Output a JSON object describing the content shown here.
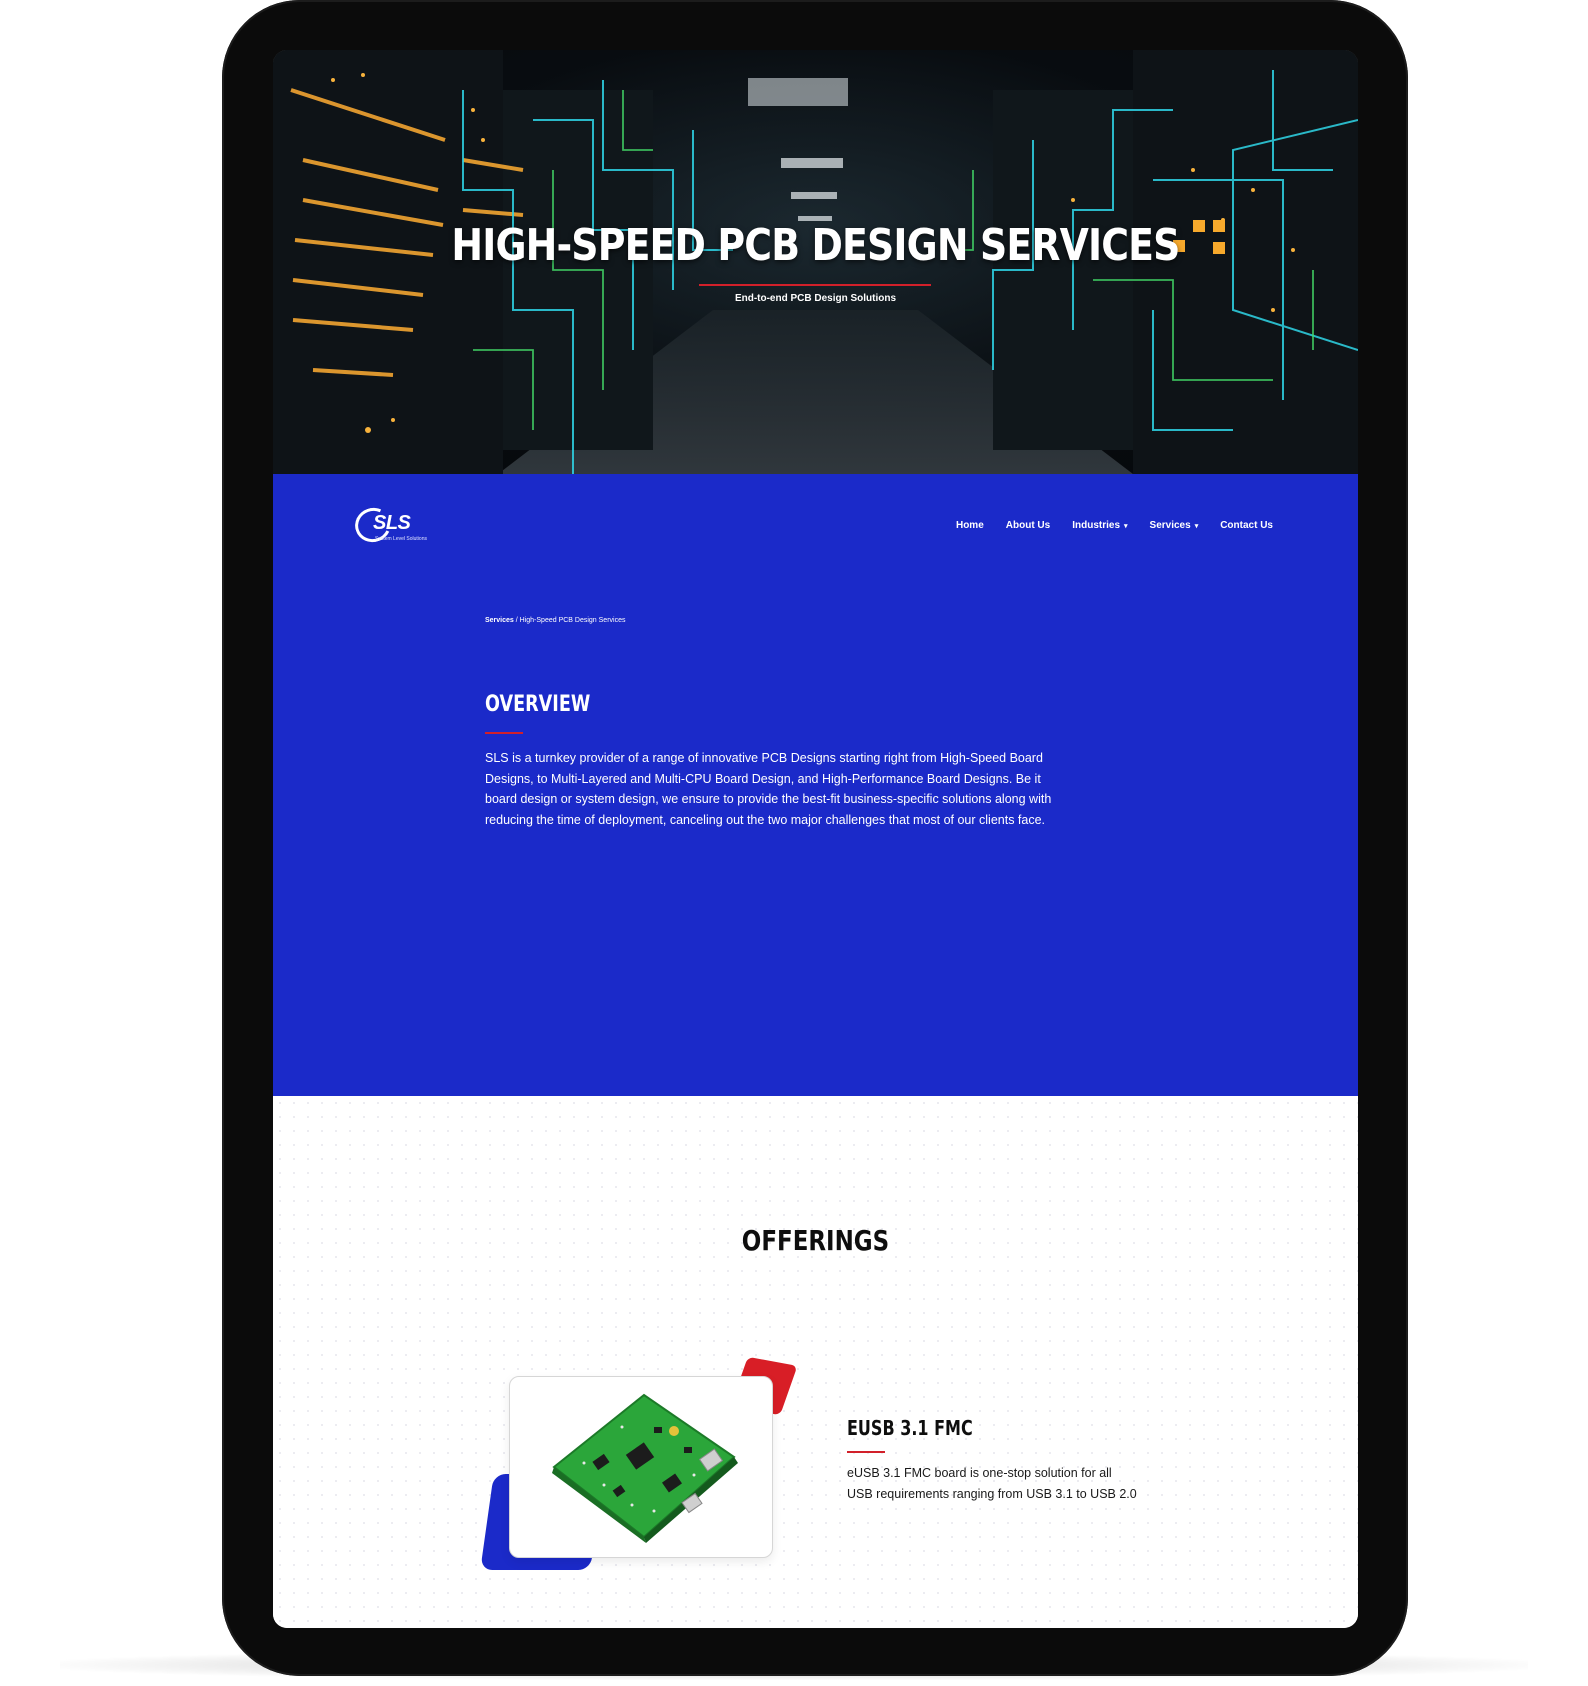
{
  "hero": {
    "title": "HIGH-SPEED PCB DESIGN SERVICES",
    "subtitle": "End-to-end PCB Design Solutions"
  },
  "brand": {
    "logo_text": "SLS",
    "logo_tagline": "System Level Solutions"
  },
  "nav": {
    "items": [
      {
        "label": "Home",
        "has_dropdown": false
      },
      {
        "label": "About Us",
        "has_dropdown": false
      },
      {
        "label": "Industries",
        "has_dropdown": true
      },
      {
        "label": "Services",
        "has_dropdown": true
      },
      {
        "label": "Contact Us",
        "has_dropdown": false
      }
    ],
    "caret": "▾"
  },
  "breadcrumb": {
    "parent": "Services",
    "separator": " / ",
    "current": "High-Speed PCB Design Services"
  },
  "overview": {
    "title": "OVERVIEW",
    "text": "SLS is a turnkey provider of a range of innovative PCB Designs starting right from High-Speed Board Designs, to Multi-Layered and Multi-CPU Board Design, and High-Performance Board Designs. Be it board design or system design, we ensure to provide the best-fit business-specific solutions along with reducing the time of deployment, canceling out the two major challenges that most of our clients face."
  },
  "offerings": {
    "title": "OFFERINGS",
    "items": [
      {
        "title": "EUSB 3.1 FMC",
        "description": "eUSB 3.1 FMC board is one-stop solution for all USB requirements ranging from USB 3.1 to USB 2.0"
      }
    ]
  },
  "colors": {
    "primary_blue": "#1b2ac9",
    "accent_red": "#d2202a",
    "tablet_frame": "#0b0b0b"
  }
}
